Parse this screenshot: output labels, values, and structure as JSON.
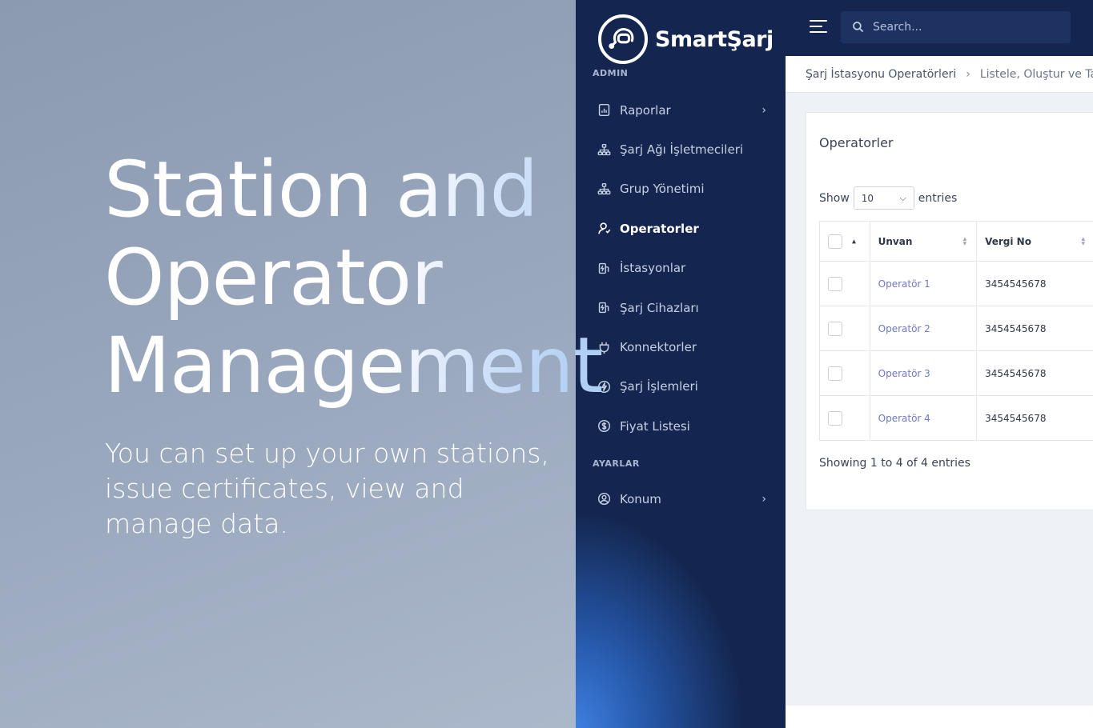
{
  "promo": {
    "title": "Station and\nOperator\nManagement",
    "subtitle": "You can set up your own stations, issue certificates, view and manage data."
  },
  "brand": {
    "name": "SmartŞarj"
  },
  "sidebar": {
    "sections": [
      {
        "label": "ADMIN"
      },
      {
        "label": "AYARLAR"
      }
    ],
    "admin_items": [
      {
        "label": "Raporlar",
        "icon": "report-icon",
        "has_arrow": true
      },
      {
        "label": "Şarj Ağı İşletmecileri",
        "icon": "network-icon"
      },
      {
        "label": "Grup Yönetimi",
        "icon": "network-icon"
      },
      {
        "label": "Operatorler",
        "icon": "user-icon",
        "active": true
      },
      {
        "label": "İstasyonlar",
        "icon": "station-icon"
      },
      {
        "label": "Şarj Cihazları",
        "icon": "station-icon"
      },
      {
        "label": "Konnektorler",
        "icon": "plug-icon"
      },
      {
        "label": "Şarj İşlemleri",
        "icon": "bolt-icon"
      },
      {
        "label": "Fiyat Listesi",
        "icon": "coin-icon"
      }
    ],
    "settings_items": [
      {
        "label": "Konum",
        "icon": "user-circle-icon",
        "has_arrow": true
      }
    ]
  },
  "topbar": {
    "search_placeholder": "Search..."
  },
  "breadcrumb": {
    "root": "Şarj İstasyonu Operatörleri",
    "current": "Listele, Oluştur ve Tasarla"
  },
  "card": {
    "title": "Operatorler",
    "show_label": "Show",
    "entries_label": "entries",
    "page_size": "10",
    "columns": [
      "Unvan",
      "Vergi No"
    ],
    "rows": [
      {
        "unvan": "Operatör 1",
        "vergi": "3454545678"
      },
      {
        "unvan": "Operatör 2",
        "vergi": "3454545678"
      },
      {
        "unvan": "Operatör 3",
        "vergi": "3454545678"
      },
      {
        "unvan": "Operatör 4",
        "vergi": "3454545678"
      }
    ],
    "info": "Showing 1 to 4 of 4 entries"
  },
  "colors": {
    "sidebar_bg": "#14264f",
    "accent_blue": "#3d7fe0",
    "link": "#6e78c9"
  }
}
